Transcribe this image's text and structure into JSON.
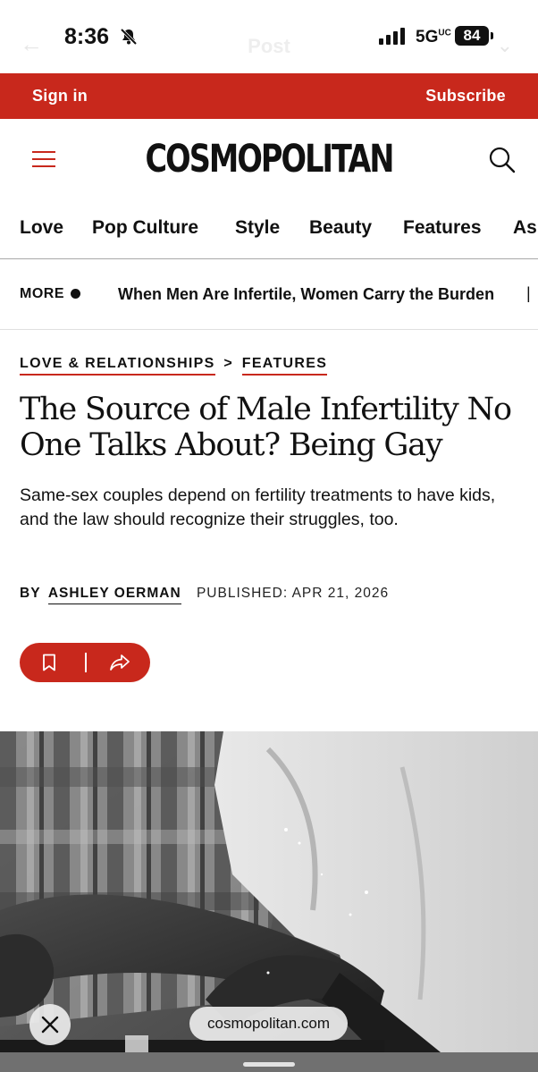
{
  "status_bar": {
    "time": "8:36",
    "network": "5G",
    "network_suffix": "UC",
    "battery": "84",
    "ghost_title": "Post"
  },
  "account_bar": {
    "sign_in": "Sign in",
    "subscribe": "Subscribe"
  },
  "header": {
    "logo": "COSMOPOLITAN"
  },
  "nav": {
    "items": [
      "Love",
      "Pop Culture",
      "Style",
      "Beauty",
      "Features",
      "As"
    ]
  },
  "more": {
    "label": "MORE",
    "headline": "When Men Are Infertile, Women Carry the Burden",
    "separator": "|"
  },
  "article": {
    "breadcrumb": {
      "section": "LOVE & RELATIONSHIPS",
      "separator": ">",
      "subsection": "FEATURES"
    },
    "headline": "The Source of Male Infertility No One Talks About? Being Gay",
    "dek": "Same-sex couples depend on fertility treatments to have kids, and the law should recognize their struggles, too.",
    "byline_label": "BY",
    "author": "ASHLEY OERMAN",
    "published": "PUBLISHED: APR 21, 2026"
  },
  "browser": {
    "url": "cosmopolitan.com"
  },
  "colors": {
    "brand_red": "#c8281c",
    "text": "#111111"
  },
  "icons": [
    "bell-slash-icon",
    "signal-icon",
    "battery-icon",
    "hamburger-menu-icon",
    "search-icon",
    "bookmark-icon",
    "share-icon",
    "close-icon"
  ]
}
